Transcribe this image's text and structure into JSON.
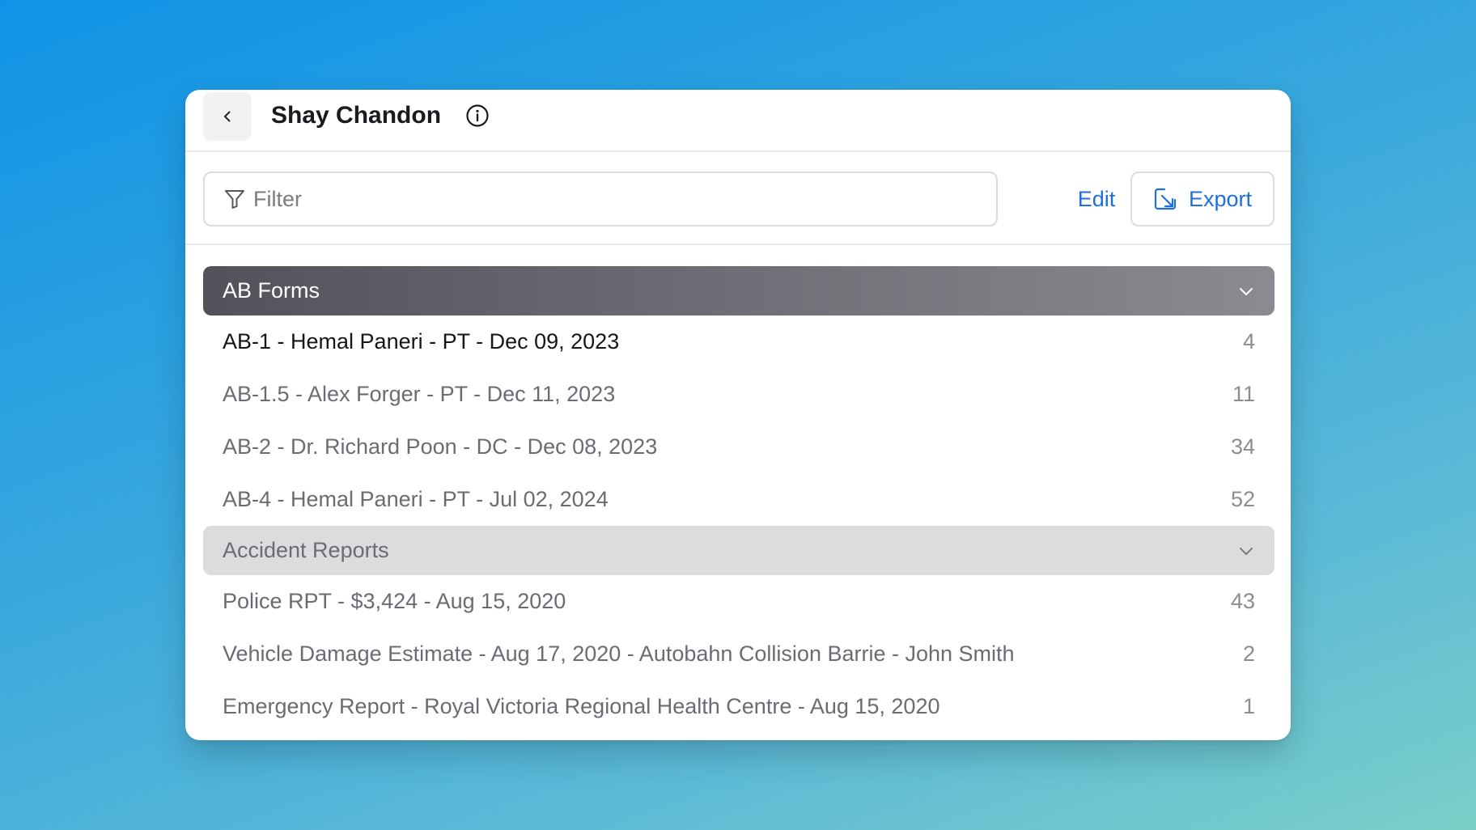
{
  "header": {
    "title": "Shay Chandon"
  },
  "toolbar": {
    "filter_placeholder": "Filter",
    "edit_label": "Edit",
    "export_label": "Export"
  },
  "colors": {
    "accent": "#1f6fe0",
    "active_group_start": "#52525b",
    "active_group_end": "#8a8a90",
    "inactive_group": "#dcdcde"
  },
  "groups": [
    {
      "label": "AB Forms",
      "expanded": true,
      "items": [
        {
          "label": "AB-1 - Hemal Paneri - PT - Dec 09, 2023",
          "count": "4"
        },
        {
          "label": "AB-1.5 - Alex Forger - PT - Dec 11, 2023",
          "count": "11"
        },
        {
          "label": "AB-2 - Dr. Richard Poon - DC - Dec 08, 2023",
          "count": "34"
        },
        {
          "label": "AB-4 - Hemal Paneri - PT - Jul 02, 2024",
          "count": "52"
        }
      ]
    },
    {
      "label": "Accident Reports",
      "expanded": true,
      "items": [
        {
          "label": "Police RPT - $3,424 - Aug 15, 2020",
          "count": "43"
        },
        {
          "label": "Vehicle Damage Estimate - Aug 17, 2020 - Autobahn Collision Barrie - John Smith",
          "count": "2"
        },
        {
          "label": "Emergency Report - Royal Victoria Regional Health Centre - Aug 15, 2020",
          "count": "1"
        }
      ]
    }
  ]
}
